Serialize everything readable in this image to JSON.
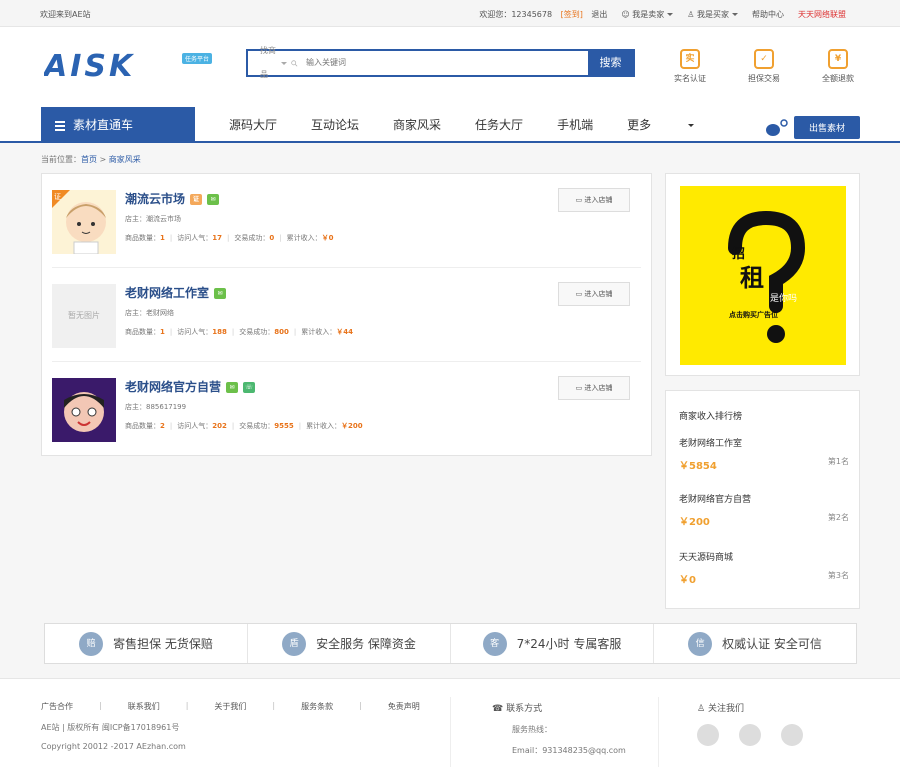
{
  "topbar": {
    "welcome": "欢迎来到AE站",
    "user_greeting": "欢迎您：",
    "username": "12345678",
    "signin": "[签到]",
    "logout": "退出",
    "seller": "我是卖家",
    "buyer": "我是买家",
    "help": "帮助中心",
    "alliance": "天天网络联盟"
  },
  "header": {
    "logo": "AISK",
    "logo_sub": "任务平台",
    "search_category": "找商品",
    "search_placeholder": "输入关键词",
    "search_button": "搜索",
    "badges": [
      {
        "icon": "实",
        "label": "实名认证"
      },
      {
        "icon": "✓",
        "label": "担保交易"
      },
      {
        "icon": "¥",
        "label": "全额退款"
      }
    ]
  },
  "nav": {
    "category_label": "素材直通车",
    "links": [
      "源码大厅",
      "互动论坛",
      "商家风采",
      "任务大厅",
      "手机端",
      "更多"
    ],
    "sell_button": "出售素材"
  },
  "breadcrumb": {
    "prefix": "当前位置：",
    "home": "首页",
    "sep": " > ",
    "current": "商家风采"
  },
  "shops": [
    {
      "name": "潮流云市场",
      "owner": "店主：潮流云市场",
      "stat_labels": [
        "商品数量：",
        "访问人气：",
        "交易成功：",
        "累计收入："
      ],
      "stat_values": [
        "1",
        "17",
        "0",
        "￥0"
      ],
      "enter": "进入店铺",
      "avatar": "cartoon-boy",
      "corner": "证",
      "tags": [
        "orange-cert",
        "green-mail"
      ]
    },
    {
      "name": "老财网络工作室",
      "owner": "店主：老财网络",
      "stat_labels": [
        "商品数量：",
        "访问人气：",
        "交易成功：",
        "累计收入："
      ],
      "stat_values": [
        "1",
        "188",
        "800",
        "￥44"
      ],
      "enter": "进入店铺",
      "avatar": "no-image",
      "no_image_text": "暂无图片",
      "tags": [
        "green-mail"
      ]
    },
    {
      "name": "老财网络官方自营",
      "owner": "店主：885617199",
      "stat_labels": [
        "商品数量：",
        "访问人气：",
        "交易成功：",
        "累计收入："
      ],
      "stat_values": [
        "2",
        "202",
        "9555",
        "￥200"
      ],
      "enter": "进入店铺",
      "avatar": "cartoon-face",
      "tags": [
        "green-mail",
        "green-phone"
      ]
    }
  ],
  "ad": {
    "line1": "招",
    "line2": "租",
    "line3": "是你吗",
    "line4": "点击购买广告位"
  },
  "ranking": {
    "title": "商家收入排行榜",
    "items": [
      {
        "name": "老财网络工作室",
        "value": "￥5854",
        "place": "第1名"
      },
      {
        "name": "老财网络官方自营",
        "value": "￥200",
        "place": "第2名"
      },
      {
        "name": "天天源码商城",
        "value": "￥0",
        "place": "第3名"
      }
    ]
  },
  "guarantees": [
    {
      "icon": "赔",
      "text": "寄售担保  无货保赔"
    },
    {
      "icon": "盾",
      "text": "安全服务  保障资金"
    },
    {
      "icon": "客",
      "text": "7*24小时  专属客服"
    },
    {
      "icon": "信",
      "text": "权威认证  安全可信"
    }
  ],
  "footer": {
    "links": [
      "广告合作",
      "联系我们",
      "关于我们",
      "服务条款",
      "免责声明"
    ],
    "copyright1": "AE站 | 版权所有 闽ICP备17018961号",
    "copyright2": "Copyright 20012 -2017 AEzhan.com",
    "contact_title": "联系方式",
    "hotline": "服务热线：",
    "email": "Email：931348235@qq.com",
    "follow_title": "关注我们"
  },
  "colors": {
    "primary": "#2b5aa6",
    "accent": "#e8731a",
    "gold": "#f0a030",
    "ad_yellow": "#ffea00"
  }
}
